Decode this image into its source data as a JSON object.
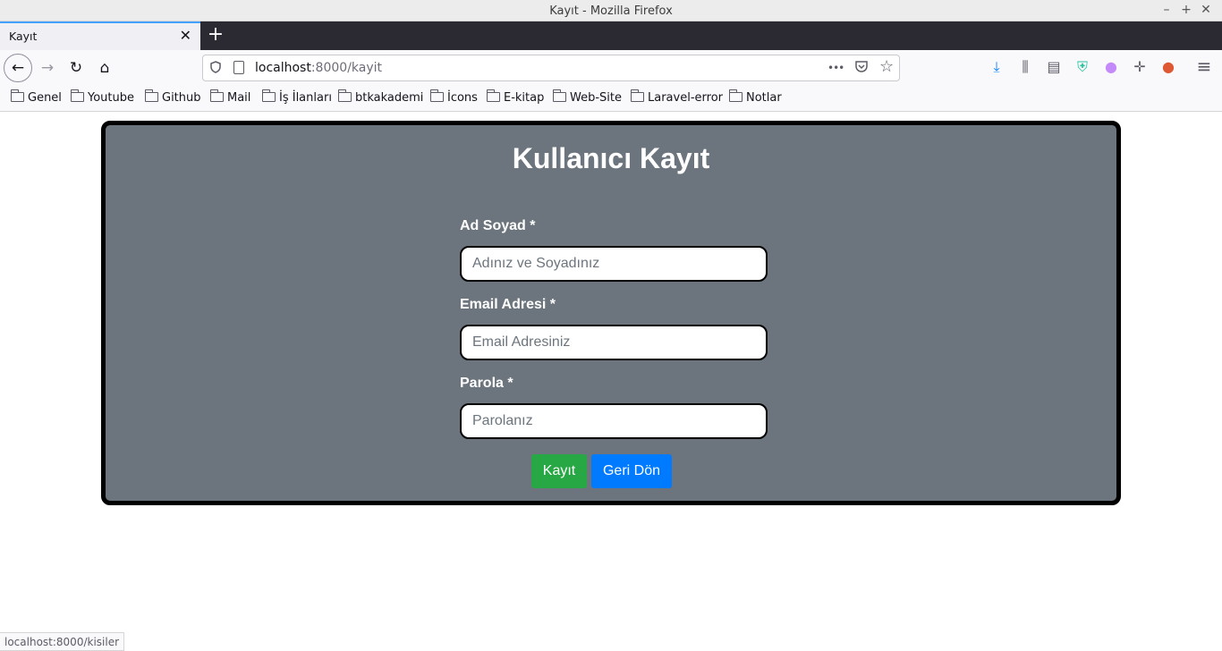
{
  "window": {
    "title": "Kayıt - Mozilla Firefox",
    "minimize": "–",
    "maximize": "+",
    "close": "✕"
  },
  "tabs": [
    {
      "label": "Kayıt",
      "close": "✕"
    }
  ],
  "new_tab": "+",
  "nav": {
    "back": "←",
    "forward": "→",
    "reload": "↻",
    "home": "⌂"
  },
  "url": {
    "host": "localhost",
    "path": ":8000/kayit"
  },
  "url_actions": {
    "more": "•••",
    "pocket": "♡",
    "bookmark": "☆"
  },
  "toolbar_icons": [
    "download-icon",
    "library-icon",
    "sidebar-icon",
    "shield-extension-icon",
    "color-extension-icon",
    "move-extension-icon",
    "duckduckgo-icon",
    "menu-icon"
  ],
  "toolbar_glyphs": {
    "download": "⤓",
    "library": "⫼",
    "sidebar": "▤",
    "shield": "⛨",
    "color": "●",
    "move": "✛",
    "duck": "●",
    "menu": "≡"
  },
  "bookmarks": [
    "Genel",
    "Youtube",
    "Github",
    "Mail",
    "İş İlanları",
    "btkakademi",
    "İcons",
    "E-kitap",
    "Web-Site",
    "Laravel-error",
    "Notlar"
  ],
  "form": {
    "title": "Kullanıcı Kayıt",
    "name_label": "Ad Soyad *",
    "name_placeholder": "Adınız ve Soyadınız",
    "email_label": "Email Adresi *",
    "email_placeholder": "Email Adresiniz",
    "password_label": "Parola *",
    "password_placeholder": "Parolanız",
    "submit_label": "Kayıt",
    "back_label": "Geri Dön"
  },
  "status_url": "localhost:8000/kisiler",
  "colors": {
    "card_bg": "#6c757d",
    "submit_bg": "#28a745",
    "back_bg": "#007bff",
    "download_icon": "#0a84ff",
    "shield_icon": "#2ac3a2",
    "duck_icon": "#de5833"
  }
}
